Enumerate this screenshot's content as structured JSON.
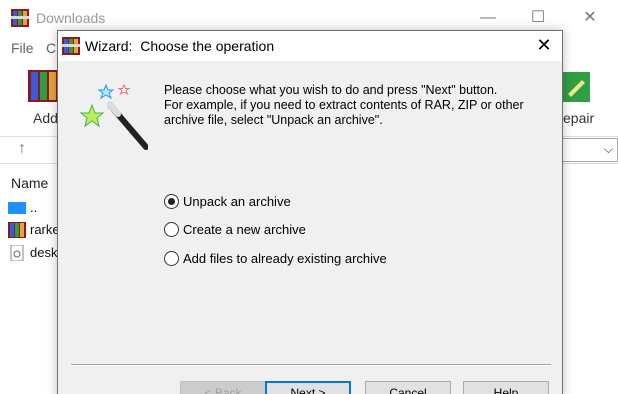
{
  "background_window": {
    "title": "Downloads",
    "menu": [
      "File",
      "C"
    ],
    "toolbar": {
      "left_label": "Add",
      "right_label": "epair"
    },
    "list": {
      "header": "Name",
      "rows": [
        "..",
        "rarke",
        "desk"
      ]
    }
  },
  "dialog": {
    "title": "Wizard:  Choose the operation",
    "close": "✕",
    "instructions": [
      "Please choose what you wish to do and press \"Next\" button.",
      "For example, if you need to extract contents of RAR, ZIP or other",
      "archive file, select \"Unpack an archive\"."
    ],
    "options": [
      {
        "label": "Unpack an archive",
        "checked": true
      },
      {
        "label": "Create a new archive",
        "checked": false
      },
      {
        "label": "Add files to already existing archive",
        "checked": false
      }
    ],
    "buttons": {
      "back": "< Back",
      "next": "Next >",
      "cancel": "Cancel",
      "help": "Help"
    }
  },
  "colors": {
    "dialog_bg": "#f0f0f0",
    "default_button_border": "#0078d7"
  }
}
